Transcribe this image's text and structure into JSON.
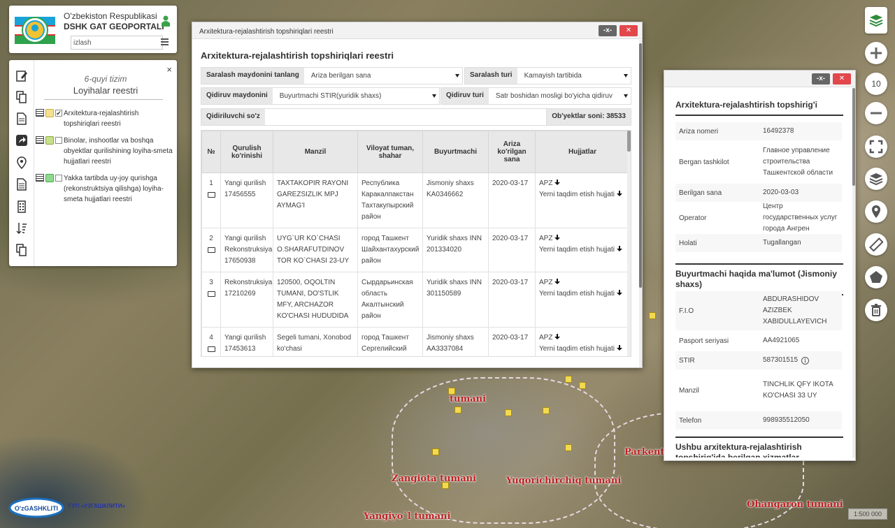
{
  "header": {
    "title_line1": "O'zbekiston Respublikasi",
    "title_line2": "DSHK GAT GEOPORTALI",
    "search_value": "izlash"
  },
  "layers_panel": {
    "subtitle": "6-quyi tizim",
    "title": "Loyihalar reestri",
    "close_label": "×",
    "items": [
      {
        "label": "Arxitektura-rejalashtirish topshiriqlari reestri",
        "swatch": "#f5e08e",
        "checked": true
      },
      {
        "label": "Binolar, inshootlar va boshqa obyektlar qurilishining loyiha-smeta hujjatlari reestri",
        "swatch": "#c8e08a",
        "checked": false
      },
      {
        "label": "Yakka tartibda uy-joy qurishga (rekonstruktsiya qilishga) loyiha-smeta hujjatlari reestri",
        "swatch": "#8fd98f",
        "checked": false
      }
    ]
  },
  "registry_window": {
    "window_title": "Arxitektura-rejalashtirish topshiriqlari reestri",
    "heading": "Arxitektura-rejalashtirish topshiriqlari reestri",
    "min_label": "-x-",
    "close_label": "✕",
    "sort_field_label": "Saralash maydonini tanlang",
    "sort_field_value": "Ariza berilgan sana",
    "sort_type_label": "Saralash turi",
    "sort_type_value": "Kamayish tartibida",
    "search_field_label": "Qidiruv maydonini",
    "search_field_value": "Buyurtmachi STIR(yuridik shaxs)",
    "search_type_label": "Qidiruv turi",
    "search_type_value": "Satr boshidan mosligi bo'yicha qidiruv",
    "search_word_label": "Qidiriluvchi so'z",
    "search_word_value": "",
    "count_label": "Ob'yektlar soni: 38533",
    "columns": [
      "№",
      "Qurulish ko'rinishi",
      "Manzil",
      "Viloyat tuman, shahar",
      "Buyurtmachi",
      "Ariza ko'rilgan sana",
      "Hujjatlar"
    ],
    "rows": [
      {
        "num": "1",
        "type": "Yangi qurilish 17456555",
        "address": "TAXTAKOPIR RAYONI GAREZSIZLIK MPJ AYMAG'I",
        "region": "Республика Каракалпакстан Тахтакупырский район",
        "customer": "Jismoniy shaxs KA0346662",
        "date": "2020-03-17",
        "doc1": "APZ",
        "doc2": "Yerni taqdim etish hujjati"
      },
      {
        "num": "2",
        "type": "Yangi qurilish Rekonstruksiya 17650938",
        "address": "UYG`UR KO`CHASI O.SHARAFUTDINOV TOR KO`CHASI 23-UY",
        "region": "город Ташкент Шайхантахурский район",
        "customer": "Yuridik shaxs INN 201334020",
        "date": "2020-03-17",
        "doc1": "APZ",
        "doc2": "Yerni taqdim etish hujjati"
      },
      {
        "num": "3",
        "type": "Rekonstruksiya 17210269",
        "address": "120500, OQOLTIN TUMANI, DO'STLIK MFY, ARCHAZOR KO'CHASI HUDUDIDA",
        "region": "Сырдарьинская область Акалтынский район",
        "customer": "Yuridik shaxs INN 301150589",
        "date": "2020-03-17",
        "doc1": "APZ",
        "doc2": "Yerni taqdim etish hujjati"
      },
      {
        "num": "4",
        "type": "Yangi qurilish 17453613",
        "address": "Segeli tumani, Xonobod ko'chasi",
        "region": "город Ташкент Сергелийский район",
        "customer": "Jismoniy shaxs AA3337084",
        "date": "2020-03-17",
        "doc1": "APZ",
        "doc2": "Yerni taqdim etish hujjati"
      }
    ]
  },
  "details_window": {
    "min_label": "-x-",
    "close_label": "✕",
    "section1_title": "Arxitektura-rejalashtirish topshirig'i",
    "section1_rows": [
      {
        "key": "Ariza nomeri",
        "value": "16492378"
      },
      {
        "key": "Bergan tashkilot",
        "value": "Главное управление строительства Ташкентской области"
      },
      {
        "key": "Berilgan sana",
        "value": "2020-03-03"
      },
      {
        "key": "Operator",
        "value": "Центр государственных услуг города Ангрен"
      },
      {
        "key": "Holati",
        "value": "Tugallangan"
      }
    ],
    "section2_title": "Buyurtmachi haqida ma'lumot (Jismoniy shaxs)",
    "section2_rows": [
      {
        "key": "F.I.O",
        "value": "ABDURASHIDOV AZIZBEK XABIDULLAYEVICH"
      },
      {
        "key": "Pasport seriyasi",
        "value": "AA4921065"
      },
      {
        "key": "STIR",
        "value": "587301515"
      },
      {
        "key": "Manzil",
        "value": "TINCHLIK QFY IKOTA KO'CHASI 33 UY"
      },
      {
        "key": "Telefon",
        "value": "998935512050"
      }
    ],
    "section3_title": "Ushbu arxitektura-rejalashtirish topshirig'ida berilgan xizmatlar"
  },
  "map": {
    "zoom_level": "10",
    "scale": "1:500 000",
    "labels": [
      "Zangiota tumani",
      "Yuqorichirchiq tumani",
      "Yangiyo`l tumani",
      "Ohangaron tumani",
      "Parkent t",
      "tumani"
    ],
    "company_logo_text": "O'zGASHKLITI",
    "company_name": "ГУП «УЗГАШКЛИТИ»"
  },
  "colors": {
    "close_button": "#e2474b",
    "tool_icon_green": "#2e8b3a",
    "map_label": "#b22222",
    "marker_yellow": "#f2d94e"
  }
}
